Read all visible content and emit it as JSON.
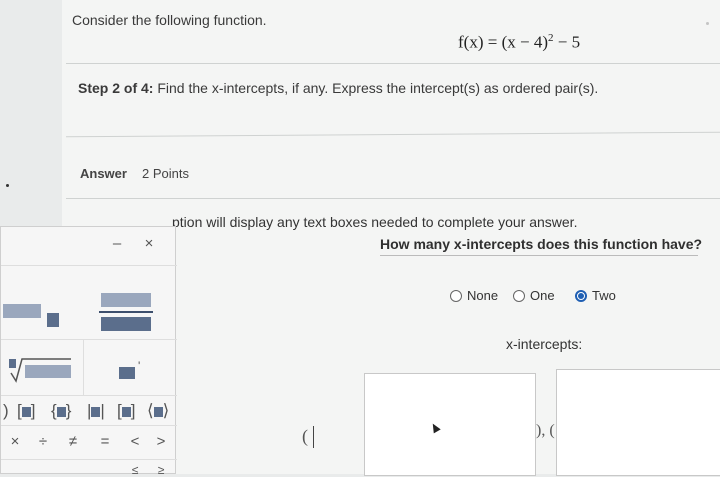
{
  "question": {
    "intro": "Consider the following function.",
    "formula_lhs": "f(x) = (x − 4)",
    "formula_exp": "2",
    "formula_rhs": " − 5",
    "step_label": "Step 2 of 4:",
    "step_text": " Find the x-intercepts, if any. Express the intercept(s) as ordered pair(s)."
  },
  "answer": {
    "label": "Answer",
    "points": "2 Points",
    "instruction": "ption will display any text boxes needed to complete your answer.",
    "prompt": "How many x-intercepts does this function have?",
    "options": [
      "None",
      "One",
      "Two"
    ],
    "selected": "Two",
    "intercepts_label": "x-intercepts:",
    "paren_open": "(",
    "separator": "), ("
  },
  "palette": {
    "minimize": "–",
    "close": "×",
    "operators": [
      "×",
      "÷",
      "≠",
      "=",
      "<",
      ">"
    ],
    "bottom_partial": [
      "≤",
      "≥"
    ]
  }
}
